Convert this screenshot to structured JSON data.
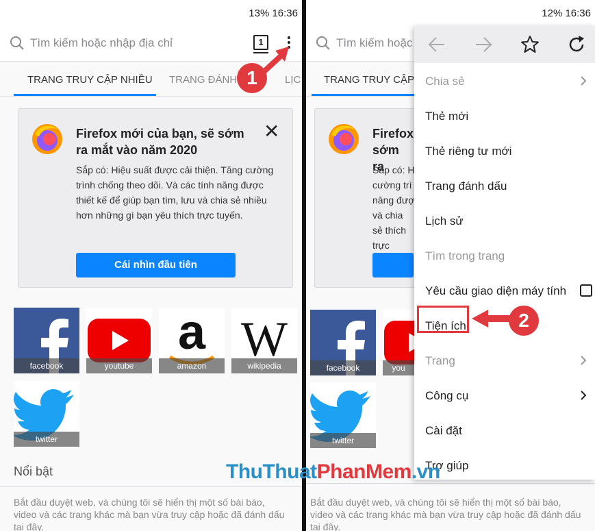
{
  "left": {
    "status": "13% 16:36",
    "url_placeholder": "Tìm kiếm hoặc nhập địa chỉ",
    "tab_count": "1",
    "home_tabs": [
      {
        "label": "TRANG TRUY CẬP NHIỀU",
        "active": true
      },
      {
        "label": "TRANG ĐÁNH",
        "active": false
      },
      {
        "label": "LỊC",
        "active": false
      }
    ],
    "card": {
      "title": "Firefox mới của bạn, sẽ sớm ra mắt vào năm 2020",
      "body": "Sắp có: Hiệu suất được cải thiện. Tăng cường trình chống theo dõi. Và các tính năng được thiết kế để giúp bạn tìm, lưu và chia sẻ nhiều hơn những gì bạn yêu thích trực tuyến.",
      "button": "Cái nhìn đầu tiên"
    },
    "tiles": [
      "facebook",
      "youtube",
      "amazon",
      "wikipedia",
      "twitter"
    ],
    "section_title": "Nổi bật",
    "section_body": "Bắt đầu duyệt web, và chúng tôi sẽ hiển thị một số bài báo, video và các trang khác mà bạn vừa truy cập hoặc đã đánh dấu tại đây."
  },
  "right": {
    "status": "12% 16:36",
    "url_placeholder": "Tìm kiếm hoặc n",
    "home_tab": "TRANG TRUY CẬP N",
    "card": {
      "title": "Firefox sớm ra",
      "body": "Sắp có: H cường trì năng đượ và chia sẻ thích trực"
    },
    "tiles": [
      "facebook",
      "you",
      "twitter"
    ],
    "section_body": "Bắt đầu duyệt web, và chúng tôi sẽ hiển thị một số bài báo, video và các trang khác mà bạn vừa truy cập hoặc đã đánh dấu tại đây.",
    "menu": {
      "toolbar_icons": [
        "back-arrow-icon",
        "forward-arrow-icon",
        "star-icon",
        "reload-icon"
      ],
      "items": [
        {
          "label": "Chia sẻ",
          "disabled": true,
          "submenu": true
        },
        {
          "label": "Thẻ mới"
        },
        {
          "label": "Thẻ riêng tư mới"
        },
        {
          "label": "Trang đánh dấu"
        },
        {
          "label": "Lịch sử"
        },
        {
          "label": "Tìm trong trang",
          "disabled": true
        },
        {
          "label": "Yêu cầu giao diện máy tính",
          "checkbox": true
        },
        {
          "label": "Tiện ích",
          "highlighted": true
        },
        {
          "label": "Trang",
          "disabled": true,
          "submenu": true
        },
        {
          "label": "Công cụ",
          "submenu": true
        },
        {
          "label": "Cài đặt"
        },
        {
          "label": "Trợ giúp"
        }
      ]
    }
  },
  "annotations": {
    "step1": "1",
    "step2": "2"
  },
  "watermark": {
    "part1": "ThuThuat",
    "part2": "PhanMem",
    "part3": ".vn"
  },
  "colors": {
    "accent": "#0a84ff",
    "annotation_red": "#e0393e"
  }
}
